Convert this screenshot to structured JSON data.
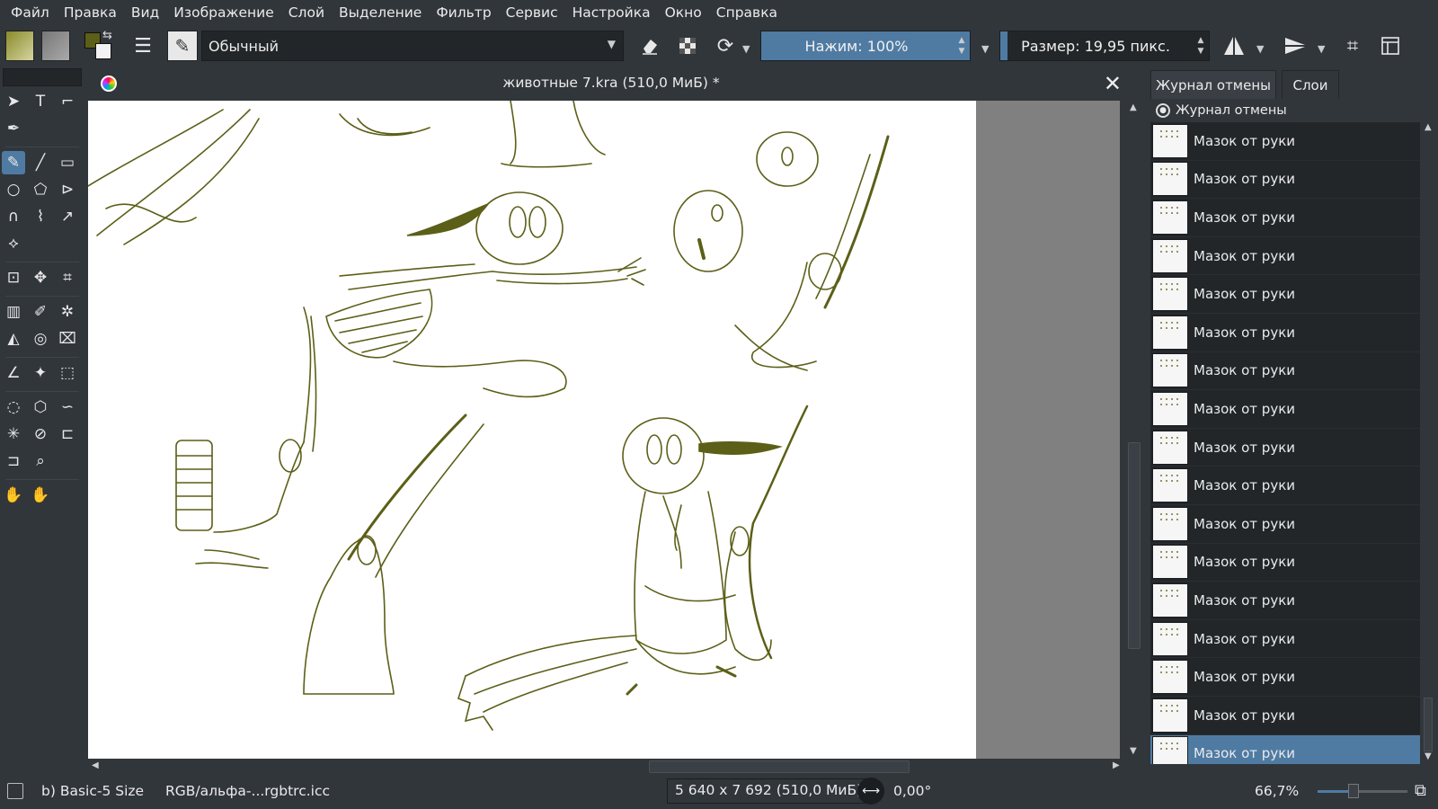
{
  "menu": [
    "Файл",
    "Правка",
    "Вид",
    "Изображение",
    "Слой",
    "Выделение",
    "Фильтр",
    "Сервис",
    "Настройка",
    "Окно",
    "Справка"
  ],
  "toolbar": {
    "blend_mode": "Обычный",
    "pressure_label": "Нажим: 100%",
    "pressure_fraction": 1.0,
    "size_label": "Размер: 19,95 пикс.",
    "size_fraction": 0.05
  },
  "document": {
    "title": "животные 7.kra (510,0 МиБ) *"
  },
  "docker": {
    "tabs": [
      "Журнал отмены",
      "Слои"
    ],
    "header": "Журнал отмены",
    "entries": [
      "Мазок от руки",
      "Мазок от руки",
      "Мазок от руки",
      "Мазок от руки",
      "Мазок от руки",
      "Мазок от руки",
      "Мазок от руки",
      "Мазок от руки",
      "Мазок от руки",
      "Мазок от руки",
      "Мазок от руки",
      "Мазок от руки",
      "Мазок от руки",
      "Мазок от руки",
      "Мазок от руки",
      "Мазок от руки",
      "Мазок от руки"
    ],
    "selected_index": 16
  },
  "status": {
    "brush": "b) Basic-5 Size",
    "color_profile": "RGB/альфа-...rgbtrc.icc",
    "dimensions": "5 640 x 7 692 (510,0 МиБ)",
    "rotation": "0,00°",
    "zoom": "66,7%",
    "zoom_fraction": 0.4
  },
  "colors": {
    "accent": "#4f7ba3",
    "background": "#31363b",
    "ink": "#5c5f17"
  },
  "icons": {
    "tools": [
      "select-shapes-icon",
      "text-icon",
      "edit-shapes-icon",
      "calligraphy-icon",
      "freehand-brush-icon",
      "line-icon",
      "rectangle-icon",
      "ellipse-icon",
      "polygon-icon",
      "polyline-icon",
      "bezier-icon",
      "freehand-path-icon",
      "dynamic-brush-icon",
      "multibrush-icon",
      "transform-icon",
      "move-icon",
      "crop-icon",
      "gradient-icon",
      "color-picker-icon",
      "smart-patch-icon",
      "fill-icon",
      "enclose-fill-icon",
      "assistant-icon",
      "measure-icon",
      "reference-icon",
      "rect-select-icon",
      "ellipse-select-icon",
      "polygon-select-icon",
      "freehand-select-icon",
      "contiguous-select-icon",
      "similar-select-icon",
      "bezier-select-icon",
      "magnetic-select-icon",
      "zoom-icon",
      "pan-icon"
    ]
  }
}
